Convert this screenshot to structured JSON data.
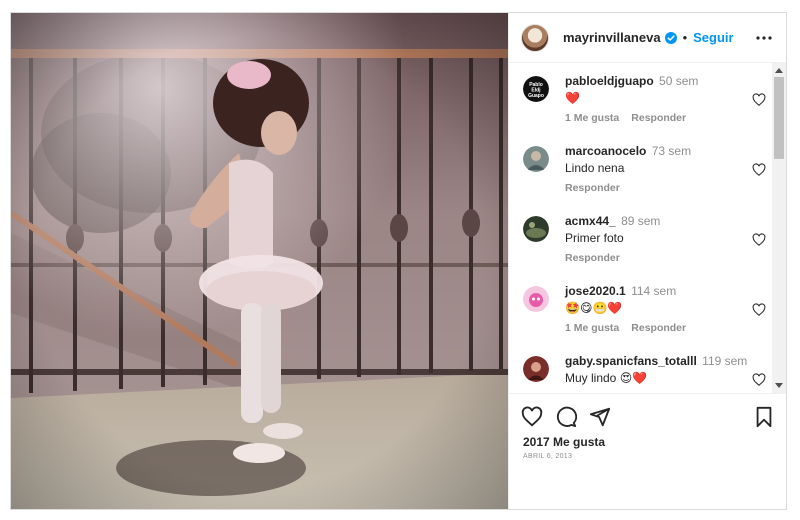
{
  "post": {
    "username": "mayrinvillaneva",
    "separator": "•",
    "follow_label": "Seguir",
    "likes": "2017 Me gusta",
    "date": "ABRIL 6, 2013"
  },
  "colors": {
    "accent": "#0095f6",
    "heart": "#ed4956",
    "text": "#262626",
    "muted": "#8e8e8e"
  },
  "comments": [
    {
      "user": "pabloeldjguapo",
      "time": "50 sem",
      "text": "❤️",
      "likes": "1 Me gusta",
      "reply": "Responder"
    },
    {
      "user": "marcoanocelo",
      "time": "73 sem",
      "text": "Lindo nena",
      "likes": "",
      "reply": "Responder"
    },
    {
      "user": "acmx44_",
      "time": "89 sem",
      "text": "Primer foto",
      "likes": "",
      "reply": "Responder"
    },
    {
      "user": "jose2020.1",
      "time": "114 sem",
      "text": "🤩😋😬❤️",
      "likes": "1 Me gusta",
      "reply": "Responder"
    },
    {
      "user": "gaby.spanicfans_totalll",
      "time": "119 sem",
      "text": "Muy lindo 😍❤️",
      "likes": "",
      "reply": ""
    }
  ],
  "icons": {
    "verified": "verified-badge-icon",
    "more": "more-options-icon",
    "like": "heart-icon",
    "comment": "comment-icon",
    "share": "share-icon",
    "save": "bookmark-icon"
  }
}
